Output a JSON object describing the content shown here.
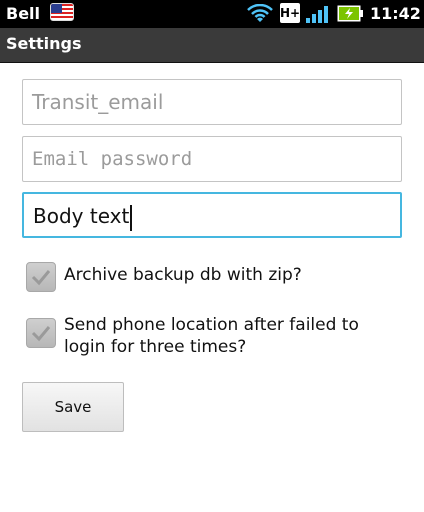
{
  "status_bar": {
    "carrier": "Bell",
    "icons": [
      "us-flag-icon",
      "wifi-icon",
      "hplus-network-icon",
      "signal-icon",
      "battery-charging-icon"
    ],
    "network_type": "H+",
    "time": "11:42"
  },
  "title_bar": {
    "title": "Settings"
  },
  "form": {
    "account_field": {
      "placeholder": "Transit_email",
      "value": ""
    },
    "password_field": {
      "placeholder": "Email password",
      "value": ""
    },
    "body_field": {
      "placeholder": "",
      "value": "Body text"
    },
    "checkbox_archive": {
      "label": "Archive backup db with zip?",
      "checked": false
    },
    "checkbox_location": {
      "label": "Send phone location after failed to login for three times?",
      "checked": false
    },
    "save_label": "Save"
  },
  "colors": {
    "focus_border": "#45b7e0",
    "titlebar_bg": "#3a3a3a",
    "statusbar_bg": "#000000"
  }
}
